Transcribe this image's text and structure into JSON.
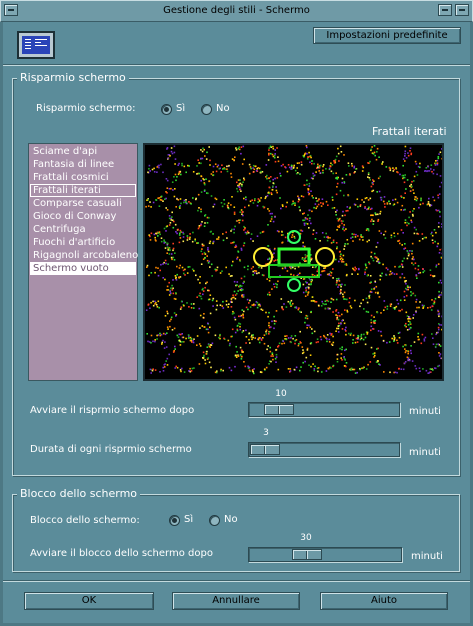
{
  "window": {
    "title": "Gestione degli stili - Schermo"
  },
  "toolbar": {
    "defaults_label": "Impostazioni predefinite"
  },
  "screensaver_group": {
    "legend": "Risparmio schermo",
    "toggle_label": "Risparmio schermo:",
    "options": [
      "Sì",
      "No"
    ],
    "selected": "Sì",
    "preview_title": "Frattali iterati",
    "items": [
      "Sciame d'api",
      "Fantasia di linee",
      "Frattali cosmici",
      "Frattali iterati",
      "Comparse casuali",
      "Gioco di Conway",
      "Centrifuga",
      "Fuochi d'artificio",
      "Rigagnoli arcobaleno",
      "Schermo vuoto"
    ],
    "focused_item": "Frattali iterati",
    "highlighted_item": "Schermo vuoto",
    "start_after": {
      "label": "Avviare il risprmio schermo dopo",
      "value": "10",
      "unit": "minuti",
      "position_fraction": 0.12
    },
    "duration": {
      "label": "Durata di ogni risprmio schermo",
      "value": "3",
      "unit": "minuti",
      "position_fraction": 0.0
    }
  },
  "lock_group": {
    "legend": "Blocco dello schermo",
    "toggle_label": "Blocco dello schermo:",
    "options": [
      "Sì",
      "No"
    ],
    "selected": "Sì",
    "start_after": {
      "label": "Avviare il blocco dello schermo dopo",
      "value": "30",
      "unit": "minuti",
      "position_fraction": 0.35
    }
  },
  "footer": {
    "ok_label": "OK",
    "cancel_label": "Annullare",
    "help_label": "Aiuto"
  },
  "colors": {
    "background": "#5b8c9a",
    "list_background": "#a890a9",
    "preview_background": "#000000"
  }
}
